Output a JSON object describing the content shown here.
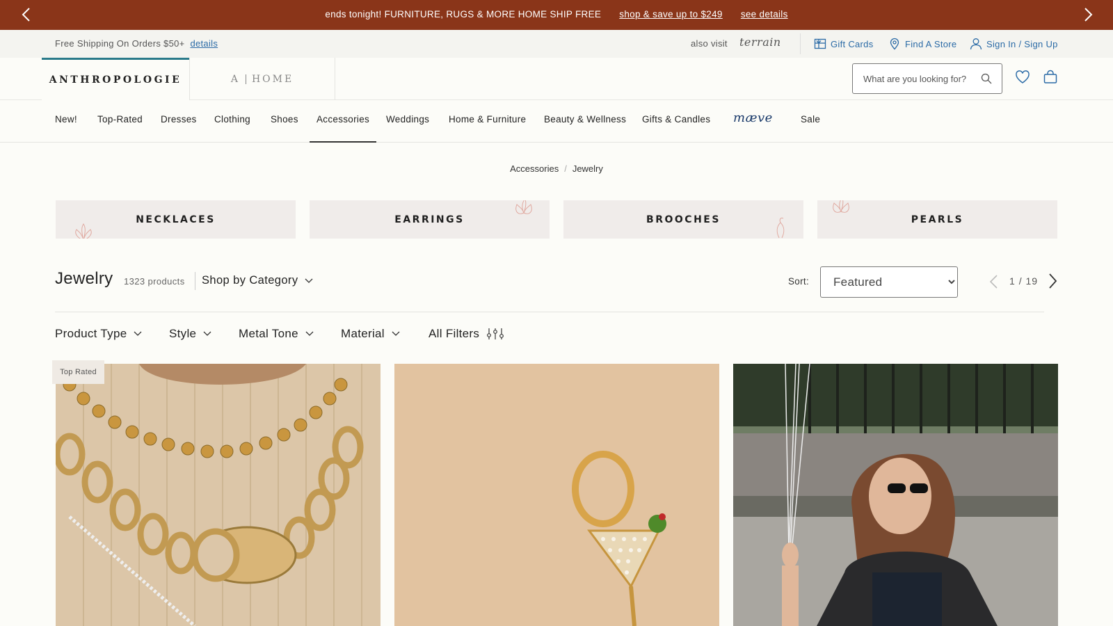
{
  "promo": {
    "message": "ends tonight! FURNITURE, RUGS & MORE HOME SHIP FREE",
    "link1": "shop & save up to $249",
    "link2": "see details"
  },
  "utility": {
    "free_shipping": "Free Shipping On Orders $50+",
    "details_link": "details",
    "also_visit": "also visit",
    "terrain": "terrain",
    "gift_cards": "Gift Cards",
    "find_store": "Find A Store",
    "sign_in": "Sign In / Sign Up"
  },
  "header": {
    "brand": "ANTHROPOLOGIE",
    "home_brand_a": "A",
    "home_brand_b": "HOME",
    "search_placeholder": "What are you looking for?"
  },
  "nav": {
    "items": [
      "New!",
      "Top-Rated",
      "Dresses",
      "Clothing",
      "Shoes",
      "Accessories",
      "Weddings",
      "Home & Furniture",
      "Beauty & Wellness",
      "Gifts & Candles",
      "Sale"
    ],
    "maeve": "mæve",
    "active": "Accessories"
  },
  "breadcrumb": [
    "Accessories",
    "Jewelry"
  ],
  "categories": [
    "NECKLACES",
    "EARRINGS",
    "BROOCHES",
    "PEARLS"
  ],
  "listing": {
    "title": "Jewelry",
    "count": "1323 products",
    "shop_by": "Shop by Category",
    "sort_label": "Sort:",
    "sort_value": "Featured",
    "page": "1",
    "page_sep": "/",
    "pages": "19"
  },
  "filters": [
    "Product Type",
    "Style",
    "Metal Tone",
    "Material",
    "All Filters"
  ],
  "products": {
    "badge": "Top Rated"
  },
  "colors": {
    "promo_bg": "#8a3519",
    "accent_teal": "#2a7a8a",
    "link_blue": "#2a6aa6",
    "page_bg": "#fcfcf8"
  }
}
